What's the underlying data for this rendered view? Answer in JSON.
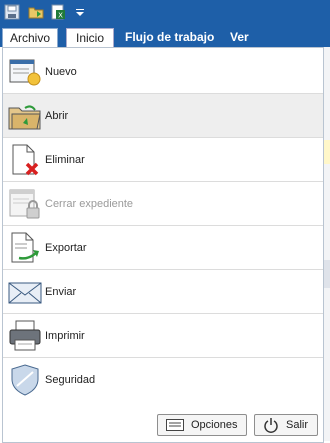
{
  "qat": {
    "icons": [
      "save-icon",
      "open-folder-icon",
      "export-excel-icon",
      "customize-dropdown-icon"
    ]
  },
  "tabs": [
    "Archivo",
    "Inicio",
    "Flujo de trabajo",
    "Ver"
  ],
  "menu": {
    "items": [
      {
        "label": "Nuevo",
        "icon": "new-document-icon",
        "enabled": true,
        "selected": false
      },
      {
        "label": "Abrir",
        "icon": "open-folder-icon",
        "enabled": true,
        "selected": true
      },
      {
        "label": "Eliminar",
        "icon": "delete-document-icon",
        "enabled": true,
        "selected": false
      },
      {
        "label": "Cerrar expediente",
        "icon": "lock-document-icon",
        "enabled": false,
        "selected": false
      },
      {
        "label": "Exportar",
        "icon": "export-document-icon",
        "enabled": true,
        "selected": false
      },
      {
        "label": "Enviar",
        "icon": "envelope-icon",
        "enabled": true,
        "selected": false
      },
      {
        "label": "Imprimir",
        "icon": "printer-icon",
        "enabled": true,
        "selected": false
      },
      {
        "label": "Seguridad",
        "icon": "shield-icon",
        "enabled": true,
        "selected": false
      }
    ],
    "options_label": "Opciones",
    "exit_label": "Salir"
  },
  "colors": {
    "titlebar": "#1e5fa8",
    "selected_row": "#eeeeee",
    "disabled_text": "#9a9a9a"
  }
}
